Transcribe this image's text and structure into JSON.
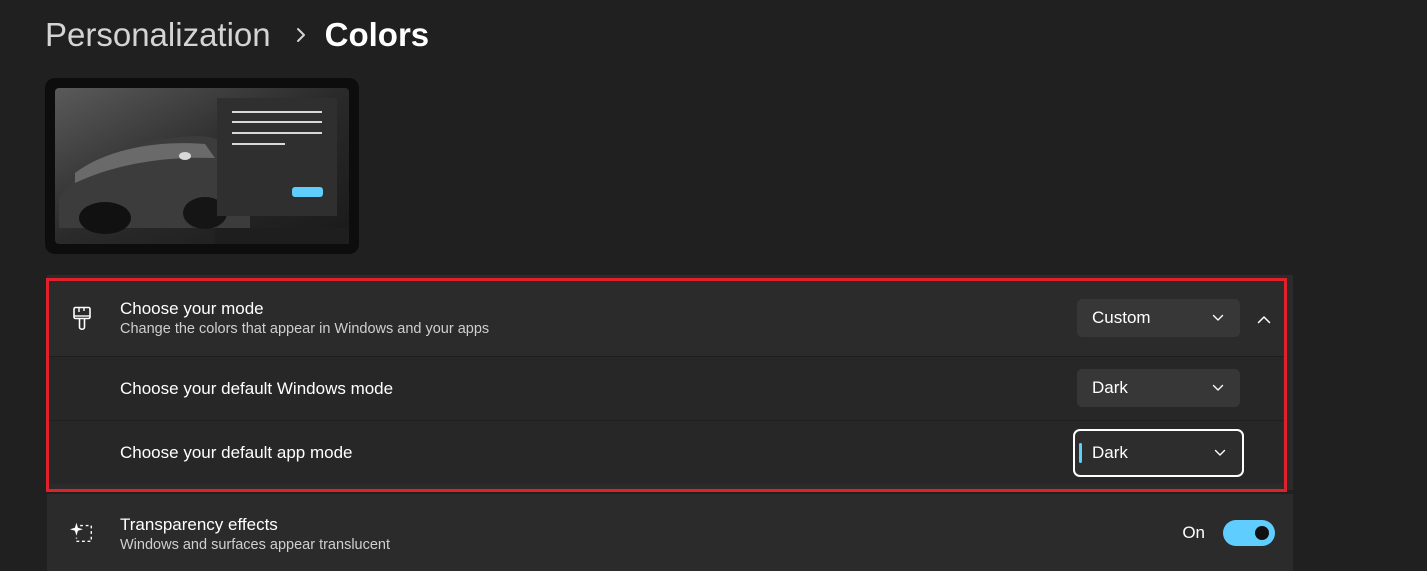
{
  "breadcrumb": {
    "parent": "Personalization",
    "current": "Colors"
  },
  "preview": {
    "icon": "theme-preview-image"
  },
  "choose_mode": {
    "title": "Choose your mode",
    "description": "Change the colors that appear in Windows and your apps",
    "selected": "Custom",
    "icon": "paintbrush-icon",
    "expanded": true
  },
  "windows_mode": {
    "title": "Choose your default Windows mode",
    "selected": "Dark"
  },
  "app_mode": {
    "title": "Choose your default app mode",
    "selected": "Dark"
  },
  "transparency": {
    "title": "Transparency effects",
    "description": "Windows and surfaces appear translucent",
    "state_label": "On",
    "enabled": true,
    "icon": "transparency-sparkle-icon"
  },
  "colors": {
    "accent": "#60cdff",
    "highlight_outline": "#e0202a",
    "background": "#202020",
    "card": "#2b2b2b"
  }
}
